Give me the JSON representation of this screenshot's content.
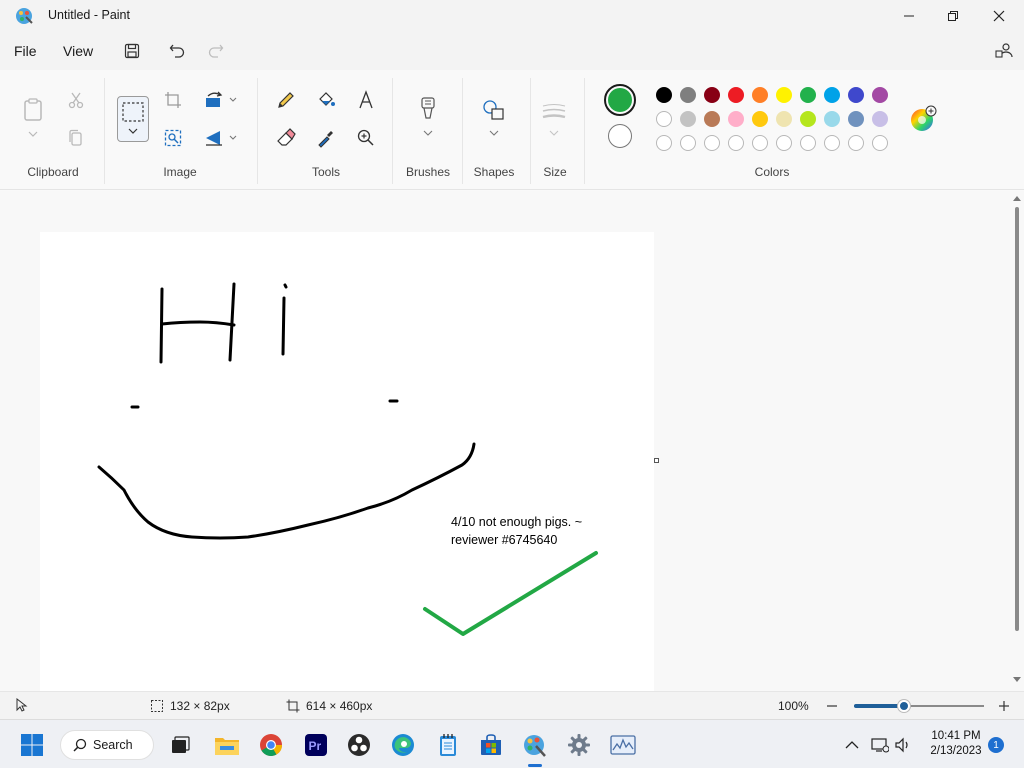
{
  "window": {
    "title": "Untitled - Paint"
  },
  "menu": {
    "file": "File",
    "view": "View"
  },
  "ribbon": {
    "groups": {
      "clipboard": "Clipboard",
      "image": "Image",
      "tools": "Tools",
      "brushes": "Brushes",
      "shapes": "Shapes",
      "size": "Size",
      "colors": "Colors"
    },
    "colors": {
      "primary": "#22a845",
      "secondary": "#ffffff",
      "row1": [
        "#000000",
        "#7f7f7f",
        "#880015",
        "#ed1c24",
        "#ff7f27",
        "#fff200",
        "#22b14c",
        "#00a2e8",
        "#3f48cc",
        "#a349a4"
      ],
      "row2": [
        "#ffffff",
        "#c3c3c3",
        "#b97a57",
        "#ffaec9",
        "#ffc90e",
        "#efe4b0",
        "#b5e61d",
        "#99d9ea",
        "#7092be",
        "#c8bfe7"
      ]
    }
  },
  "canvas": {
    "comment_line1": "4/10 not enough pigs.  ~",
    "comment_line2": "reviewer #6745640",
    "stroke_colors": {
      "black": "#000000",
      "green": "#22a845"
    }
  },
  "status": {
    "selection_size": "132 × 82px",
    "canvas_size": "614 × 460px",
    "zoom": "100%"
  },
  "taskbar": {
    "search_label": "Search",
    "time": "10:41 PM",
    "date": "2/13/2023",
    "notification_count": "1"
  }
}
